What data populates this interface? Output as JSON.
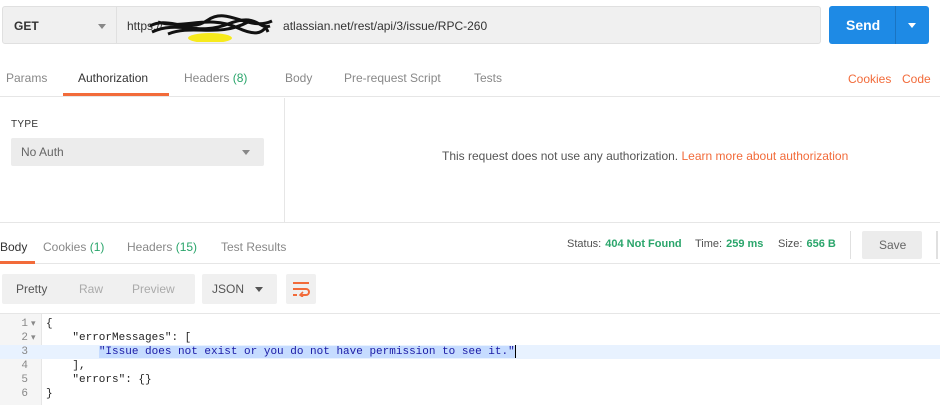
{
  "request": {
    "method": "GET",
    "url_prefix": "https://",
    "url_suffix": "atlassian.net/rest/api/3/issue/RPC-260",
    "send_label": "Send"
  },
  "request_tabs": [
    {
      "label": "Params"
    },
    {
      "label": "Authorization"
    },
    {
      "label": "Headers",
      "count": "(8)"
    },
    {
      "label": "Body"
    },
    {
      "label": "Pre-request Script"
    },
    {
      "label": "Tests"
    }
  ],
  "request_links": {
    "cookies": "Cookies",
    "code": "Code"
  },
  "auth": {
    "type_label": "TYPE",
    "type_value": "No Auth",
    "message": "This request does not use any authorization.",
    "learn_more": "Learn more about authorization"
  },
  "response_tabs": [
    {
      "label": "Body"
    },
    {
      "label": "Cookies",
      "count": "(1)"
    },
    {
      "label": "Headers",
      "count": "(15)"
    },
    {
      "label": "Test Results"
    }
  ],
  "response_status": {
    "status_label": "Status:",
    "status_value": "404 Not Found",
    "time_label": "Time:",
    "time_value": "259 ms",
    "size_label": "Size:",
    "size_value": "656 B",
    "save_label": "Save"
  },
  "format_toolbar": {
    "pretty": "Pretty",
    "raw": "Raw",
    "preview": "Preview",
    "language": "JSON"
  },
  "code_lines": [
    {
      "n": "1",
      "fold": "▾",
      "parts": [
        {
          "t": "p",
          "v": "{"
        }
      ]
    },
    {
      "n": "2",
      "fold": "▾",
      "parts": [
        {
          "t": "p",
          "v": "    "
        },
        {
          "t": "k",
          "v": "\"errorMessages\""
        },
        {
          "t": "p",
          "v": ": ["
        }
      ]
    },
    {
      "n": "3",
      "fold": "",
      "hl": true,
      "parts": [
        {
          "t": "p",
          "v": "        "
        },
        {
          "t": "s",
          "v": "\"Issue does not exist or you do not have permission to see it.\""
        }
      ]
    },
    {
      "n": "4",
      "fold": "",
      "parts": [
        {
          "t": "p",
          "v": "    ],"
        }
      ]
    },
    {
      "n": "5",
      "fold": "",
      "parts": [
        {
          "t": "p",
          "v": "    "
        },
        {
          "t": "k",
          "v": "\"errors\""
        },
        {
          "t": "p",
          "v": ": {}"
        }
      ]
    },
    {
      "n": "6",
      "fold": "",
      "parts": [
        {
          "t": "p",
          "v": "}"
        }
      ]
    }
  ],
  "colors": {
    "accent": "#f26b3a",
    "send": "#1e8ae5",
    "success": "#2aa56b"
  }
}
